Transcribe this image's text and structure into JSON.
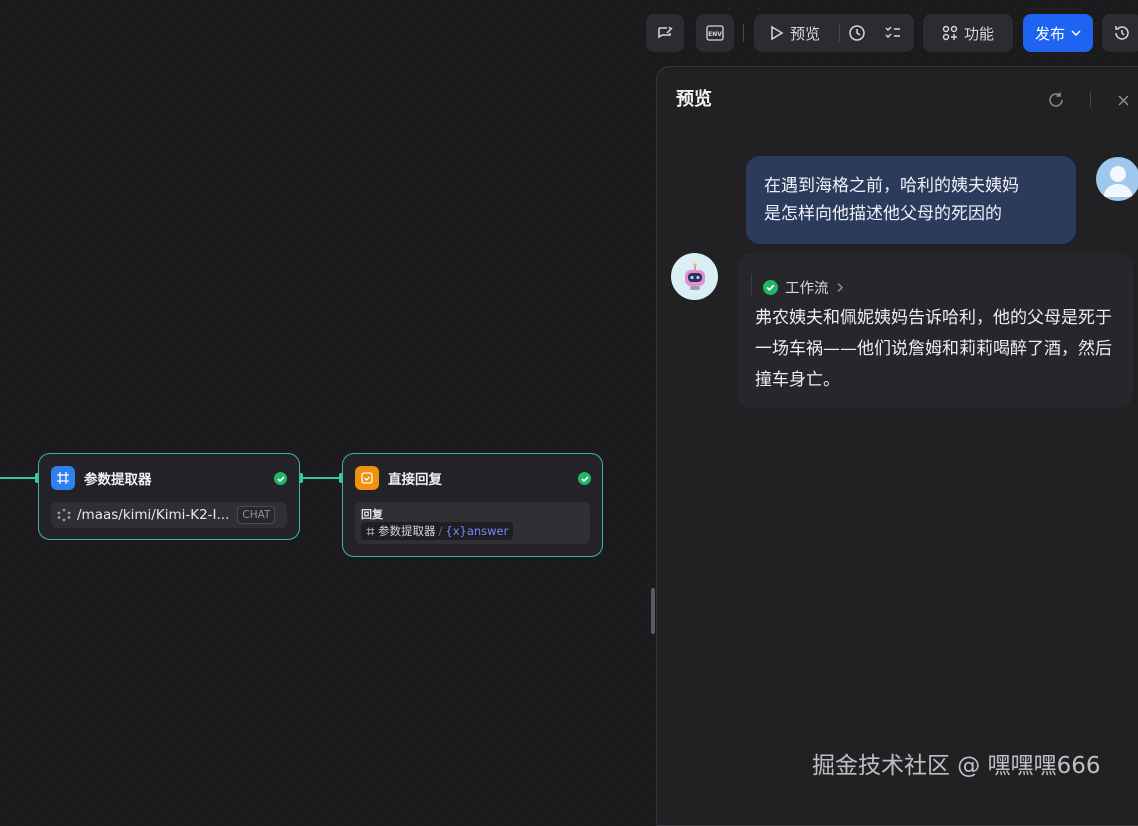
{
  "toolbar": {
    "preview_label": "预览",
    "features_label": "功能",
    "publish_label": "发布"
  },
  "nodes": {
    "param_extractor": {
      "title": "参数提取器",
      "model": "/maas/kimi/Kimi-K2-I...",
      "model_tag": "CHAT"
    },
    "direct_reply": {
      "title": "直接回复",
      "field_label": "回复",
      "var_source": "参数提取器",
      "var_slash": "/",
      "var_name": "{x}answer"
    }
  },
  "preview": {
    "title": "预览",
    "user_message_line1": "在遇到海格之前，哈利的姨夫姨妈",
    "user_message_line2": "是怎样向他描述他父母的死因的",
    "workflow_label": "工作流",
    "bot_reply": "弗农姨夫和佩妮姨妈告诉哈利，他的父母是死于一场车祸——他们说詹姆和莉莉喝醉了酒，然后撞车身亡。"
  },
  "watermark": "掘金技术社区 @ 嘿嘿嘿666",
  "colors": {
    "accent_blue": "#1e64f0",
    "node_border": "#3fb59a",
    "success_green": "#22b567",
    "variable_blue": "#6f8cff"
  }
}
